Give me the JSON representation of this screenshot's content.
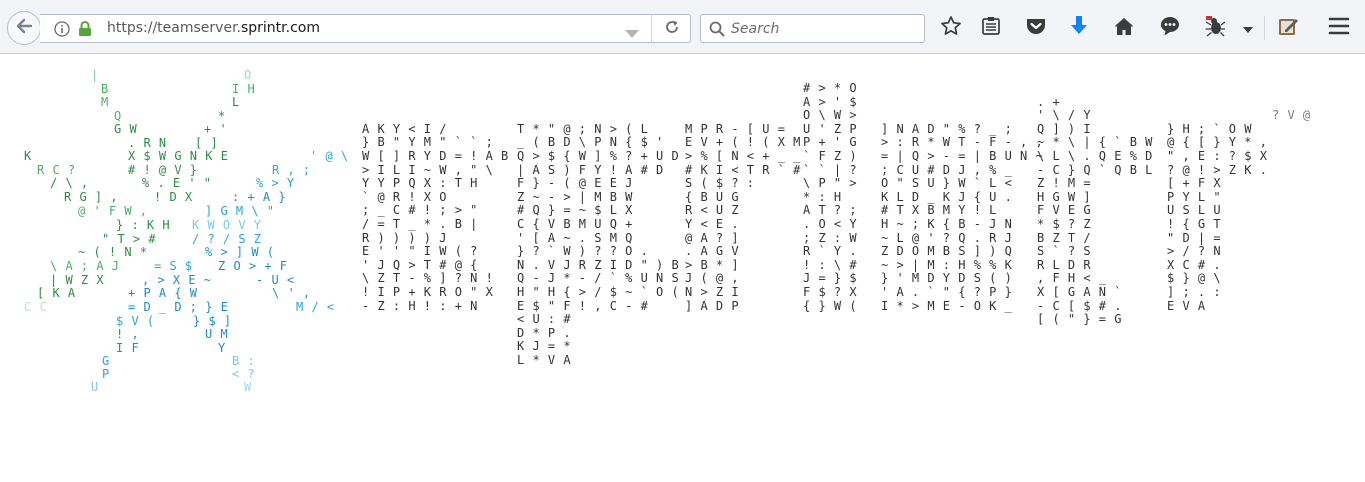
{
  "browser": {
    "url_prefix": "https://teamserver.",
    "url_domain": "sprintr.com",
    "search_placeholder": "Search",
    "icons": [
      "back-arrow-icon",
      "info-icon",
      "lock-icon",
      "dropdown-arrow-icon",
      "reload-icon",
      "search-icon",
      "bookmark-star-icon",
      "reading-list-icon",
      "pocket-icon",
      "download-arrow-icon",
      "home-icon",
      "chat-bubble-icon",
      "bug-extension-icon",
      "chevron-down-icon",
      "notepad-icon",
      "hamburger-menu-icon"
    ],
    "colors": {
      "toolbar": "#f2f4f7",
      "download": "#0a84ff",
      "lock": "#57a33c"
    }
  },
  "page": {
    "star_glyphs": [
      {
        "t": "|",
        "c": "#7fcf9a"
      },
      {
        "t": "O",
        "c": "#9fdcb0"
      },
      {
        "t": "B",
        "c": "#4caf64"
      },
      {
        "t": "I H",
        "c": "#4caf64"
      },
      {
        "t": "M",
        "c": "#4caf64"
      },
      {
        "t": "L",
        "c": "#2d8c44"
      },
      {
        "t": "Q",
        "c": "#4caf64"
      },
      {
        "t": "*",
        "c": "#2d8c44"
      },
      {
        "t": "G W",
        "c": "#2d8c44"
      },
      {
        "t": "+ '",
        "c": "#2d8c44"
      },
      {
        "t": ". R N",
        "c": "#2d8c44"
      },
      {
        "t": "[ ]",
        "c": "#2d8c44"
      },
      {
        "t": "K",
        "c": "#2d8c44"
      },
      {
        "t": "X $ W G N K E",
        "c": "#2d8c44"
      },
      {
        "t": "' @ \\",
        "c": "#2aa4d8"
      },
      {
        "t": "R C ?",
        "c": "#4caf64"
      },
      {
        "t": "# ! @ V }",
        "c": "#2d8c44"
      },
      {
        "t": "R , ;",
        "c": "#2aa4d8"
      },
      {
        "t": "/ \\ ,",
        "c": "#2d8c44"
      },
      {
        "t": "% . E ' \"",
        "c": "#2d8c44"
      },
      {
        "t": "% > Y",
        "c": "#2aa4d8"
      },
      {
        "t": "R G ] ,",
        "c": "#2d8c44"
      },
      {
        "t": "! D X",
        "c": "#2d8c44"
      },
      {
        "t": ": + A }",
        "c": "#1f8dbf"
      },
      {
        "t": "@ ' F W ,",
        "c": "#4caf64"
      },
      {
        "t": "] G M \\ \"",
        "c": "#2aa4d8"
      },
      {
        "t": "} : K H",
        "c": "#2d8c44"
      },
      {
        "t": "K W O V Y",
        "c": "#7fc6e6"
      },
      {
        "t": "\" T > #",
        "c": "#2d8c44"
      },
      {
        "t": "/ ? / S Z",
        "c": "#2aa4d8"
      },
      {
        "t": "~ ( ! N *",
        "c": "#2d8c44"
      },
      {
        "t": "% > ] W (",
        "c": "#1f8dbf"
      },
      {
        "t": "\\ A ; A J",
        "c": "#4caf64"
      },
      {
        "t": "= S $",
        "c": "#2aa4d8"
      },
      {
        "t": "Z O > + F",
        "c": "#1f8dbf"
      },
      {
        "t": "| W Z X",
        "c": "#2d8c44"
      },
      {
        "t": ", > X E ~",
        "c": "#1f8dbf"
      },
      {
        "t": "- U <",
        "c": "#1f8dbf"
      },
      {
        "t": "[ K A",
        "c": "#2d8c44"
      },
      {
        "t": "+ P A { W",
        "c": "#1f8dbf"
      },
      {
        "t": "\\ ' ,",
        "c": "#1f8dbf"
      },
      {
        "t": "C C",
        "c": "#b6e6c4"
      },
      {
        "t": "= D _ D ; } E",
        "c": "#1f8dbf"
      },
      {
        "t": "M / <",
        "c": "#2aa4d8"
      },
      {
        "t": "$ V (",
        "c": "#2aa4d8"
      },
      {
        "t": "} $ ]",
        "c": "#1f8dbf"
      },
      {
        "t": "! ,",
        "c": "#1f8dbf"
      },
      {
        "t": "U M",
        "c": "#1f8dbf"
      },
      {
        "t": "I F",
        "c": "#1f8dbf"
      },
      {
        "t": "Y",
        "c": "#1f8dbf"
      },
      {
        "t": "G",
        "c": "#2aa4d8"
      },
      {
        "t": "B :",
        "c": "#7fc6e6"
      },
      {
        "t": "P",
        "c": "#2aa4d8"
      },
      {
        "t": "< ?",
        "c": "#7fc6e6"
      },
      {
        "t": "U",
        "c": "#7fc6e6"
      },
      {
        "t": "W",
        "c": "#9fd4ec"
      }
    ],
    "matrix_columns": [
      [
        "",
        "",
        "",
        "A K Y < I /",
        "} B \" Y M \" ` ` ;",
        "W [ ] R Y D = ! A B",
        "> I L I    ~ W , \" \\",
        "Y Y P Q     X : T H",
        "` @ R ! X O",
        "; _ C # ! ; > \"",
        "/ = T _ * . B |",
        "R ) ) ) ) J",
        "E ' ' \"     I W ( ?",
        "' J Q >     T # @ {",
        "\\ Z T - %   ] ? N !",
        "! I P + K R O \" X",
        "- Z : H ! : + N"
      ],
      [
        "",
        "",
        "",
        "T * \" @   ; N > ( L",
        "_ ( B D \\ P N { $ '",
        "Q > $ { W ] % ? + U D",
        "| A S ) F   Y ! A # D",
        "F } - (   @ E E J",
        "Z ~ - >   | M B W",
        "# Q } =   ~ $ L X",
        "C { V B   M U Q +",
        "' [ A ~   . S M Q",
        "} ? ` W )   ? ? O .",
        "N . V J R Z I D \" ) B",
        "Q - J * - / ` % U N S",
        "H \" H { > / $ ~ ` O (",
        "E $ \" F ! , C - #",
        "< U : #",
        "D * P .",
        "K J = *",
        "L * V A"
      ],
      [
        "",
        "",
        "",
        "M P R -   [ U =",
        "E V + ( ! ( X M",
        "> % [ N < + _ _",
        "# K I < T R ` #",
        "S ( $ ? :",
        "{ B U G",
        "R < U Z",
        "Y < E .",
        "@ A ? ]",
        ". A G V",
        "> B * ]",
        "J ( @ ,",
        "N > Z I",
        "] A D P"
      ],
      [
        "# > * O",
        "A > ' $",
        "O \\ W >",
        "U ' Z P",
        "P + ' G",
        "` F Z )",
        "` ` | ?",
        "\\ P \" >",
        "* :   H",
        "A T ? ;",
        ". O < Y",
        "; Z : W",
        "R ` Y .",
        "! : \\ #",
        "J = } $",
        "F $ ? X",
        "{ } W ("
      ],
      [
        "",
        "",
        "",
        "] N A D   \" % ? _ ;",
        "> : R * W T - F - , ,",
        "= | Q > - = | B U N ~",
        "; C U # D   J , % _",
        "O \" S U }   W ` L <",
        "K L D _ K   J { U .",
        "# T X B   M Y ! L",
        "H ~ ; K {   B - J N",
        "~ L @ ' ?   Q . R J",
        "Z D O M B   S ] ) Q",
        "~ > | M :   H % % K",
        "} ' M D Y   D S ( )",
        "' A . ` \"   { ? P }",
        "I * > M E   - O K _"
      ],
      [
        "",
        ". +",
        "' \\ / Y",
        "Q ] ) I",
        "~ * \\ | { ` B W",
        "\\ L \\ . Q E % D",
        "- C } Q ` Q B L",
        "Z ! M =",
        "H G W ]",
        "F V E G",
        "* $ ? Z",
        "B Z T /",
        "S ` ? S",
        "R L D R",
        ", F H < _",
        "X [ G A N `",
        "- C [ $ # .",
        "[ ( \" } = G"
      ],
      [
        "",
        "",
        "",
        "} H ;   ` O W",
        "@ { [ } Y * ,",
        "\" , E : ? $ X",
        "? @ ! > Z K .",
        "[ + F X",
        "P Y L \"",
        "U S L U",
        "! { G T",
        "\" D | =",
        "> / ? N",
        "X C # .",
        "$ } @ \\",
        "] ; . :",
        "E V A"
      ]
    ],
    "corner_glyph": "? V @"
  }
}
